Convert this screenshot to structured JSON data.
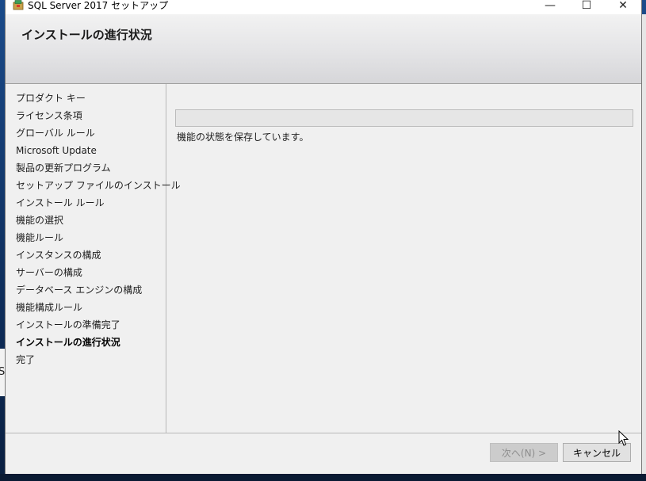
{
  "window": {
    "title": "SQL Server 2017 セットアップ",
    "minimize_glyph": "—",
    "maximize_glyph": "☐",
    "close_glyph": "✕"
  },
  "header": {
    "title": "インストールの進行状況"
  },
  "nav": {
    "items": [
      {
        "label": "プロダクト キー",
        "active": false
      },
      {
        "label": "ライセンス条項",
        "active": false
      },
      {
        "label": "グローバル ルール",
        "active": false
      },
      {
        "label": "Microsoft Update",
        "active": false
      },
      {
        "label": "製品の更新プログラム",
        "active": false
      },
      {
        "label": "セットアップ ファイルのインストール",
        "active": false
      },
      {
        "label": "インストール ルール",
        "active": false
      },
      {
        "label": "機能の選択",
        "active": false
      },
      {
        "label": "機能ルール",
        "active": false
      },
      {
        "label": "インスタンスの構成",
        "active": false
      },
      {
        "label": "サーバーの構成",
        "active": false
      },
      {
        "label": "データベース エンジンの構成",
        "active": false
      },
      {
        "label": "機能構成ルール",
        "active": false
      },
      {
        "label": "インストールの準備完了",
        "active": false
      },
      {
        "label": "インストールの進行状況",
        "active": true
      },
      {
        "label": "完了",
        "active": false
      }
    ]
  },
  "main": {
    "progress_fraction": 0.0,
    "status_text": "機能の状態を保存しています。"
  },
  "footer": {
    "next_label": "次へ(N) >",
    "cancel_label": "キャンセル"
  },
  "background": {
    "left_char": "S"
  }
}
